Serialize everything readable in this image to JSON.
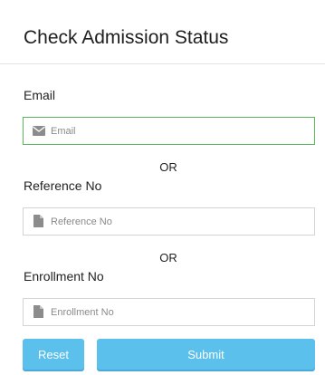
{
  "header": {
    "title": "Check Admission Status"
  },
  "form": {
    "email": {
      "label": "Email",
      "placeholder": "Email",
      "value": "",
      "icon": "envelope-icon"
    },
    "or_1": "OR",
    "reference": {
      "label": "Reference No",
      "placeholder": "Reference No",
      "value": "",
      "icon": "document-icon"
    },
    "or_2": "OR",
    "enrollment": {
      "label": "Enrollment No",
      "placeholder": "Enrollment No",
      "value": "",
      "icon": "document-icon"
    }
  },
  "actions": {
    "reset_label": "Reset",
    "submit_label": "Submit"
  },
  "colors": {
    "accent": "#5bc0eb",
    "focus_border": "#5cb85c",
    "icon": "#8c8c8c"
  }
}
